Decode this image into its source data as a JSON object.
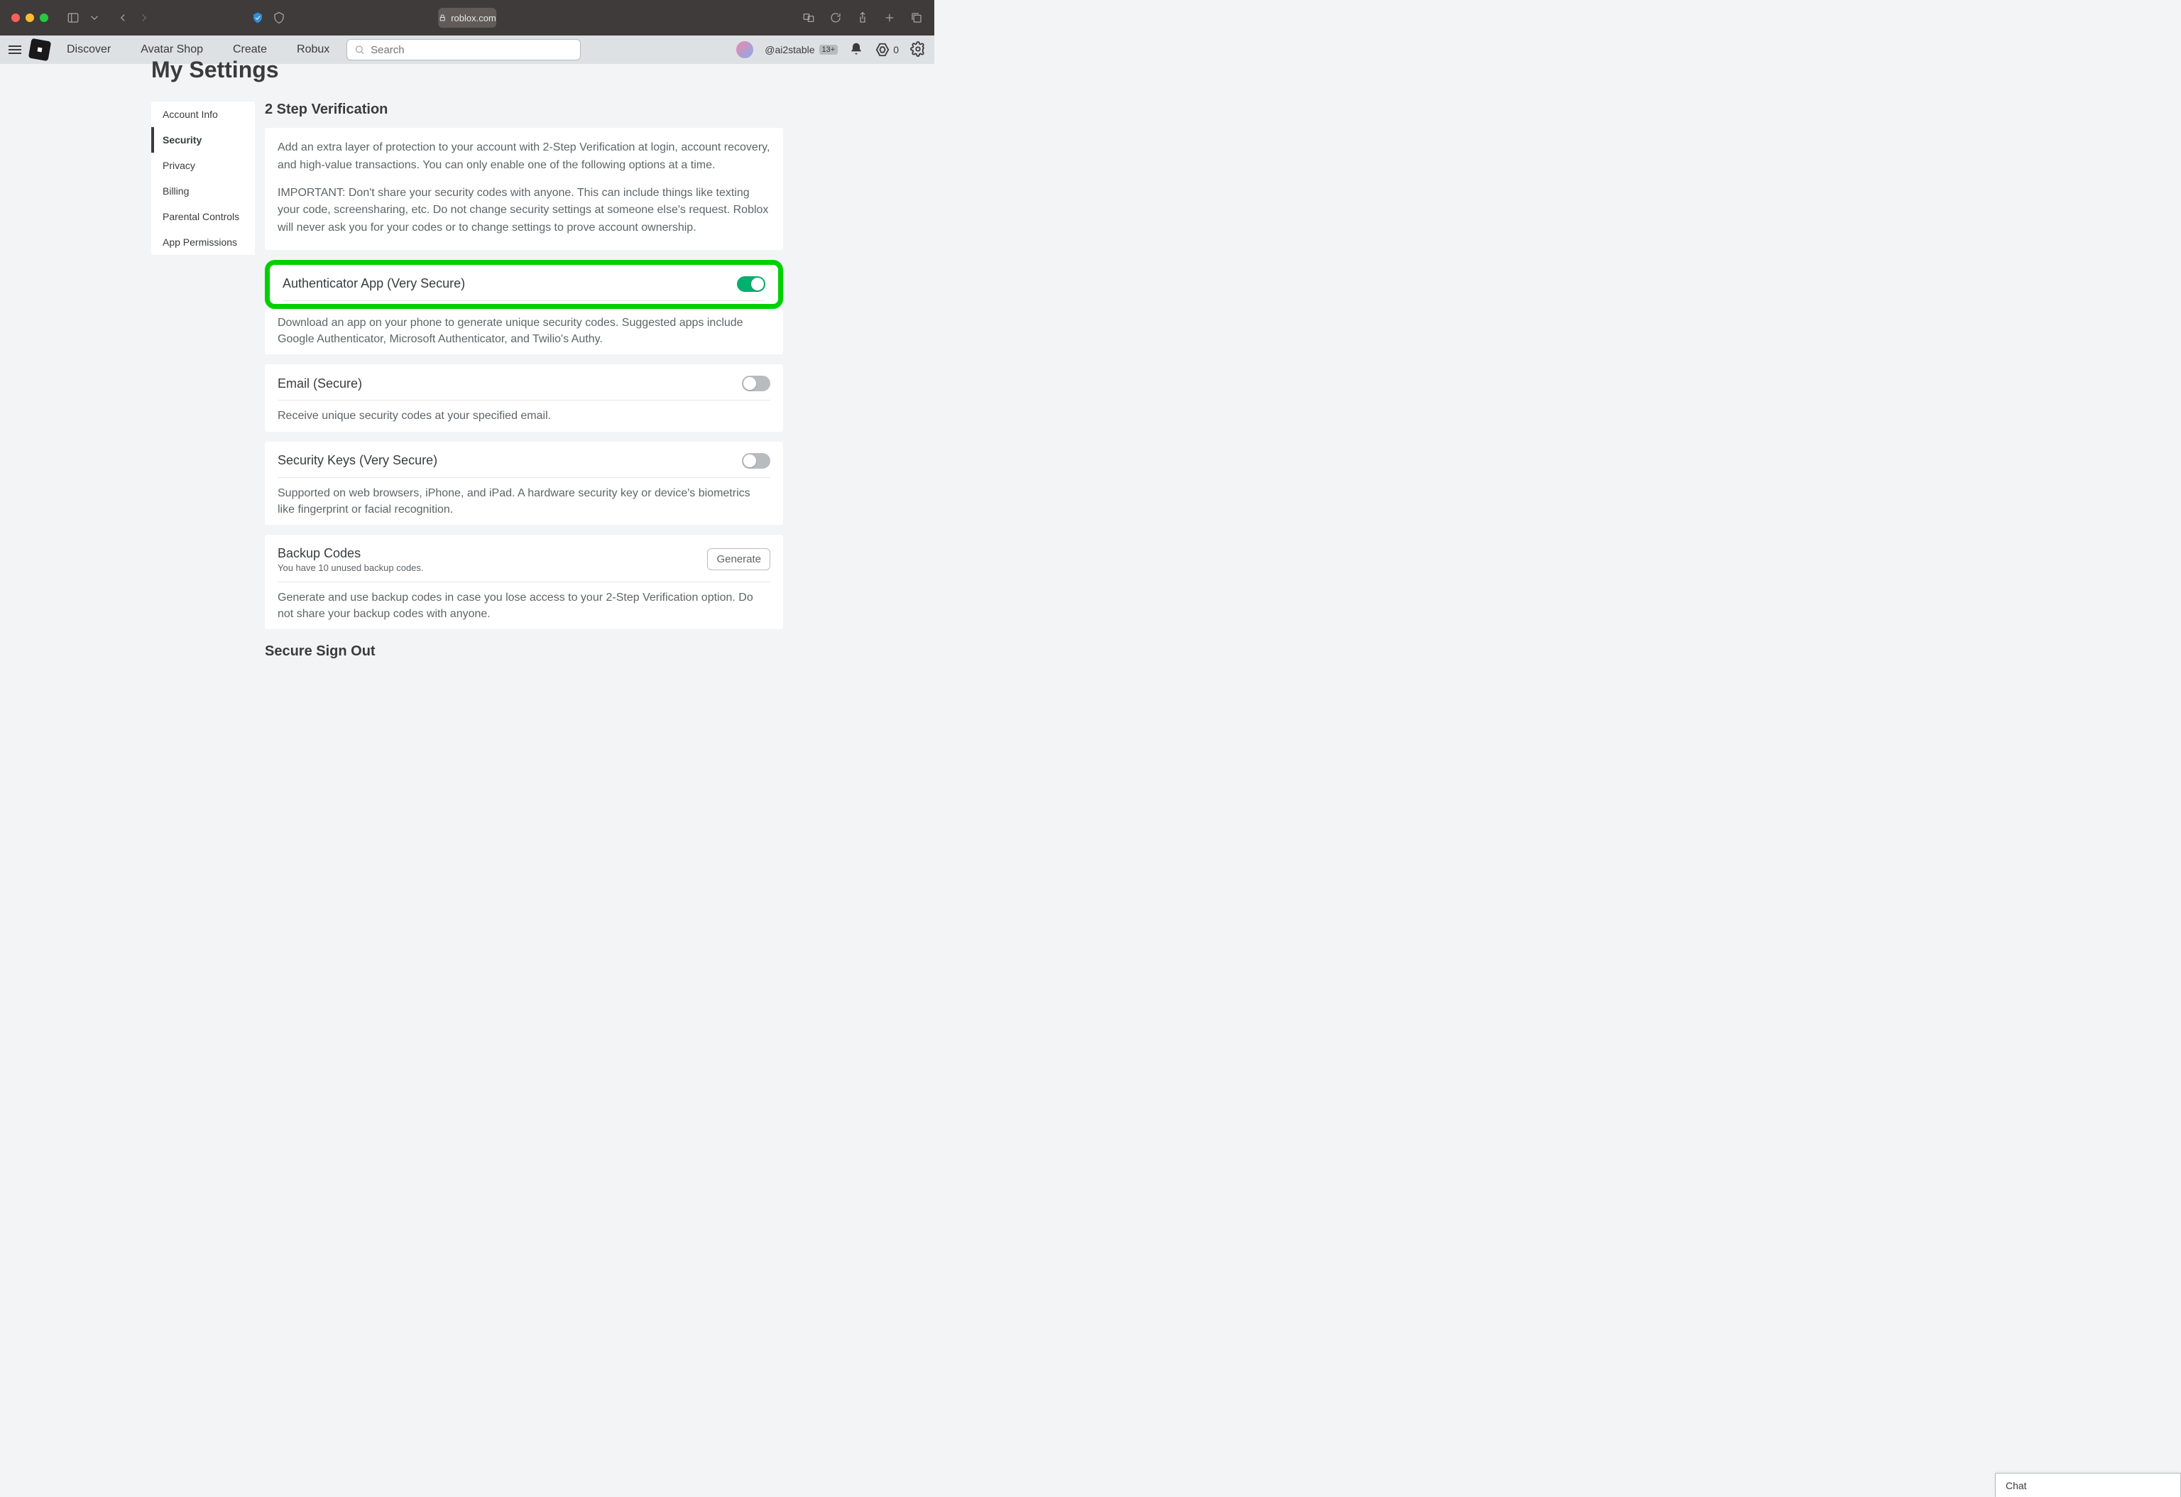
{
  "browser": {
    "url": "roblox.com"
  },
  "nav": {
    "links": [
      "Discover",
      "Avatar Shop",
      "Create",
      "Robux"
    ],
    "search_placeholder": "Search",
    "username": "@ai2stable",
    "age": "13+",
    "robux": "0"
  },
  "page_title": "My Settings",
  "sidebar": {
    "items": [
      {
        "label": "Account Info",
        "active": false
      },
      {
        "label": "Security",
        "active": true
      },
      {
        "label": "Privacy",
        "active": false
      },
      {
        "label": "Billing",
        "active": false
      },
      {
        "label": "Parental Controls",
        "active": false
      },
      {
        "label": "App Permissions",
        "active": false
      }
    ]
  },
  "section": {
    "title": "2 Step Verification",
    "intro1": "Add an extra layer of protection to your account with 2-Step Verification at login, account recovery, and high-value transactions. You can only enable one of the following options at a time.",
    "intro2": "IMPORTANT: Don't share your security codes with anyone. This can include things like texting your code, screensharing, etc. Do not change security settings at someone else's request. Roblox will never ask you for your codes or to change settings to prove account ownership."
  },
  "options": {
    "authenticator": {
      "title": "Authenticator App (Very Secure)",
      "desc": "Download an app on your phone to generate unique security codes. Suggested apps include Google Authenticator, Microsoft Authenticator, and Twilio's Authy.",
      "on": true
    },
    "email": {
      "title": "Email (Secure)",
      "desc": "Receive unique security codes at your specified email.",
      "on": false
    },
    "security_keys": {
      "title": "Security Keys (Very Secure)",
      "desc": "Supported on web browsers, iPhone, and iPad. A hardware security key or device's biometrics like fingerprint or facial recognition.",
      "on": false
    },
    "backup": {
      "title": "Backup Codes",
      "subtitle": "You have 10 unused backup codes.",
      "button": "Generate",
      "desc": "Generate and use backup codes in case you lose access to your 2-Step Verification option. Do not share your backup codes with anyone."
    }
  },
  "signout_title": "Secure Sign Out",
  "chat_label": "Chat"
}
